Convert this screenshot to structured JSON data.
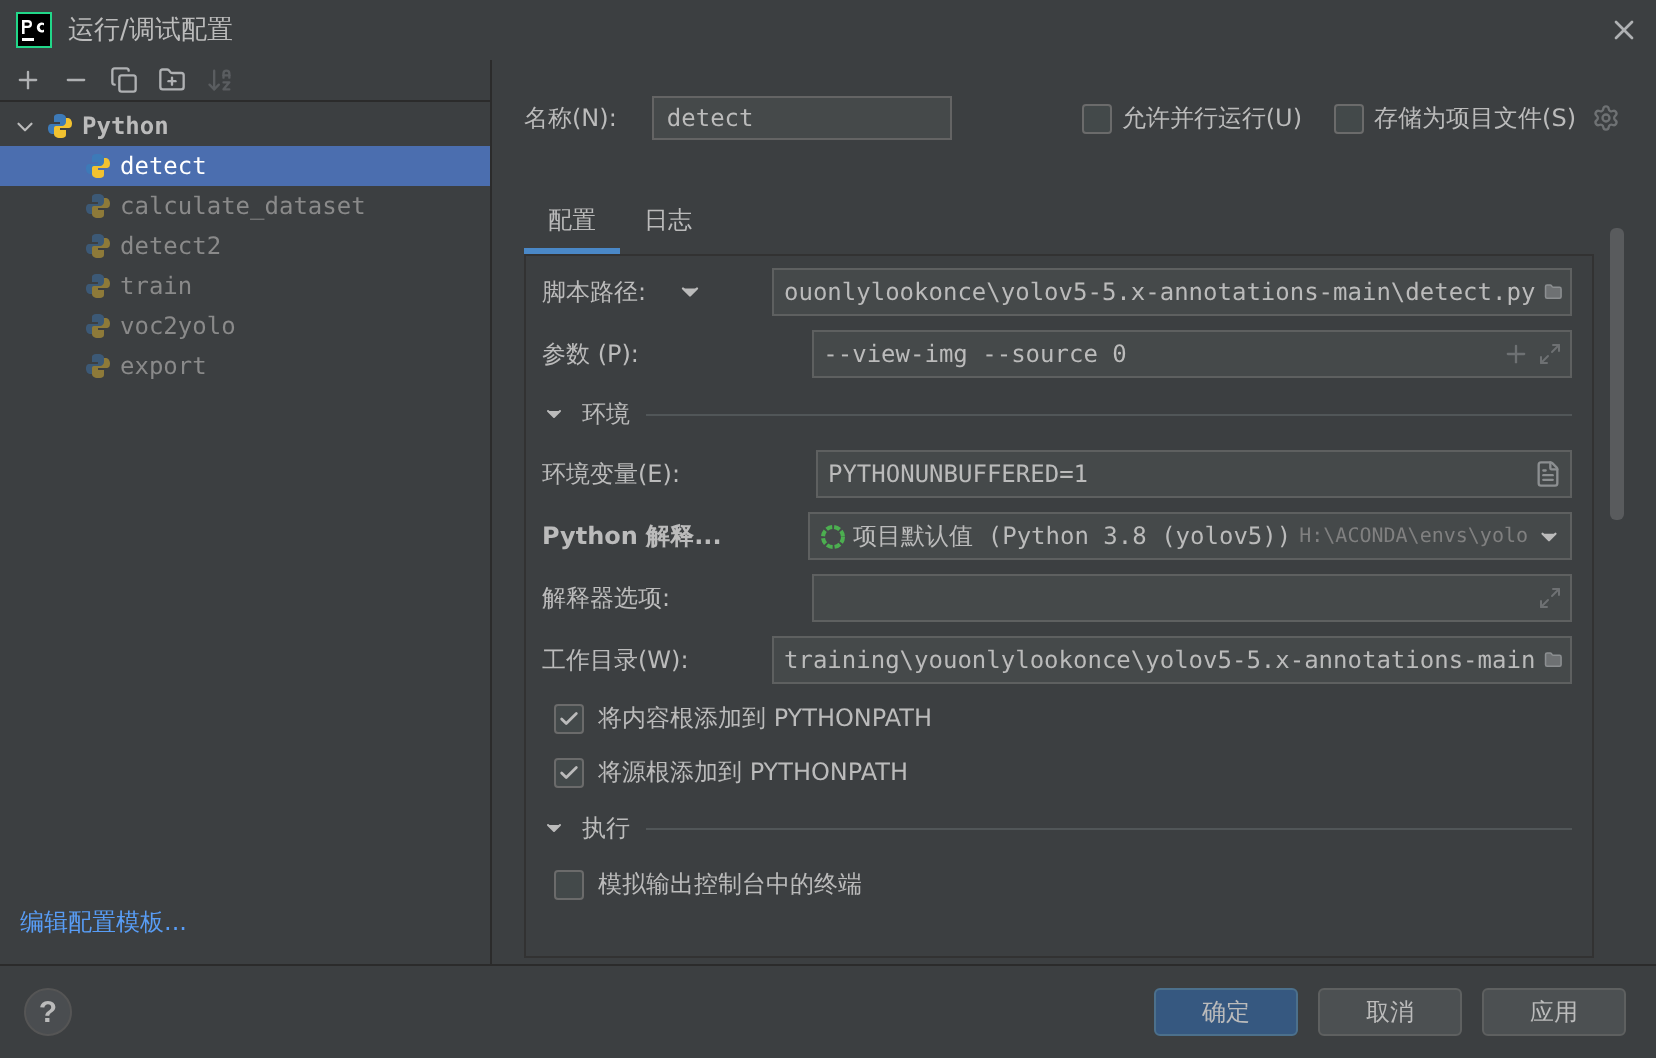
{
  "window": {
    "title": "运行/调试配置"
  },
  "toolbar": [
    {
      "kind": "add",
      "disabled": false
    },
    {
      "kind": "remove",
      "disabled": false
    },
    {
      "kind": "copy",
      "disabled": false
    },
    {
      "kind": "folder",
      "disabled": false
    },
    {
      "kind": "sort",
      "disabled": true
    }
  ],
  "tree": {
    "label": "Python",
    "expanded": true,
    "children": [
      {
        "label": "detect",
        "selected": true
      },
      {
        "label": "calculate_dataset",
        "selected": false
      },
      {
        "label": "detect2",
        "selected": false
      },
      {
        "label": "train",
        "selected": false
      },
      {
        "label": "voc2yolo",
        "selected": false
      },
      {
        "label": "export",
        "selected": false
      }
    ]
  },
  "edit_templates_link": "编辑配置模板...",
  "name": {
    "label": "名称(N):",
    "value": "detect"
  },
  "options": [
    {
      "label": "允许并行运行(U)",
      "checked": false
    },
    {
      "label": "存储为项目文件(S)",
      "checked": false
    }
  ],
  "tabs": [
    {
      "label": "配置",
      "selected": true
    },
    {
      "label": "日志",
      "selected": false
    }
  ],
  "form": [
    {
      "kind": "path",
      "label": "脚本路径:",
      "dropdown": true,
      "value": "ouonlylookonce\\yolov5-5.x-annotations-main\\detect.py"
    },
    {
      "kind": "args",
      "label": "参数 (P):",
      "value": "--view-img --source 0"
    },
    {
      "kind": "section",
      "title": "环境",
      "expanded": true
    },
    {
      "kind": "env",
      "label": "环境变量(E):",
      "value": "PYTHONUNBUFFERED=1"
    },
    {
      "kind": "interpreter",
      "label": "Python 解释...",
      "value": "项目默认值 (Python 3.8 (yolov5))",
      "hint": "H:\\ACONDA\\envs\\yolo"
    },
    {
      "kind": "options",
      "label": "解释器选项:"
    },
    {
      "kind": "path",
      "label": "工作目录(W):",
      "value": "training\\youonlylookonce\\yolov5-5.x-annotations-main"
    },
    {
      "kind": "checkbox",
      "label": "将内容根添加到 PYTHONPATH",
      "checked": true
    },
    {
      "kind": "checkbox",
      "label": "将源根添加到 PYTHONPATH",
      "checked": true
    },
    {
      "kind": "section",
      "title": "执行",
      "expanded": true
    },
    {
      "kind": "checkbox",
      "label": "模拟输出控制台中的终端",
      "checked": false
    }
  ],
  "help": "?",
  "buttons": [
    {
      "label": "确定",
      "primary": true
    },
    {
      "label": "取消",
      "primary": false
    },
    {
      "label": "应用",
      "primary": false
    }
  ]
}
